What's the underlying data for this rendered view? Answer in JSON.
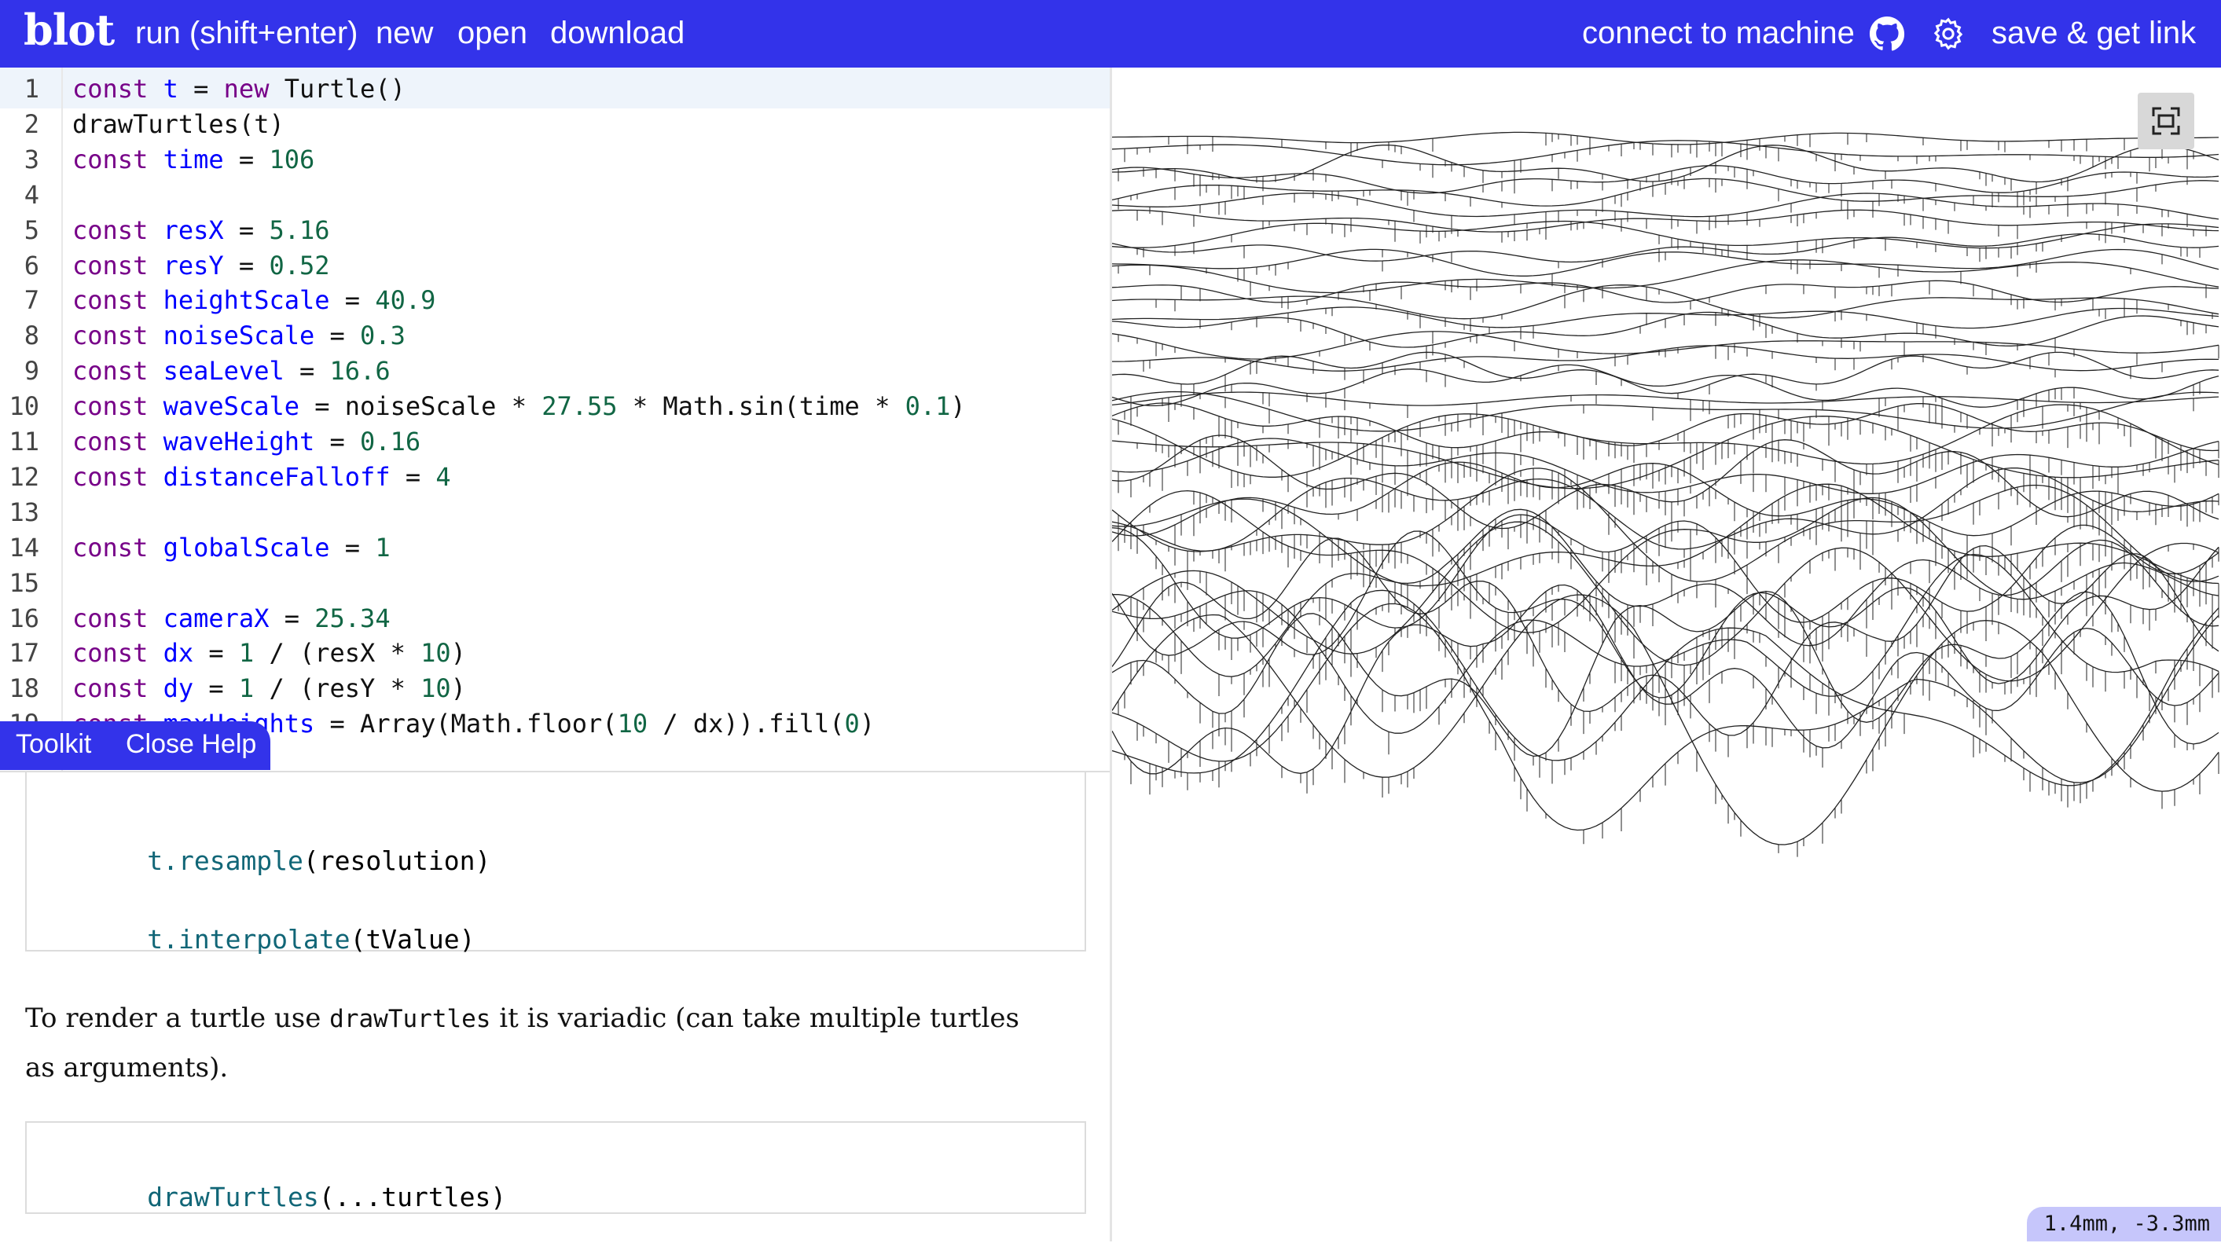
{
  "app": {
    "logo": "blot"
  },
  "nav": {
    "run": "run (shift+enter)",
    "new": "new",
    "open": "open",
    "download": "download",
    "connect": "connect to machine",
    "save": "save & get link"
  },
  "editor": {
    "line_numbers": [
      "1",
      "2",
      "3",
      "4",
      "5",
      "6",
      "7",
      "8",
      "9",
      "10",
      "11",
      "12",
      "13",
      "14",
      "15",
      "16",
      "17",
      "18",
      "19"
    ],
    "lines": [
      [
        {
          "t": "const",
          "c": "kw"
        },
        {
          "t": " "
        },
        {
          "t": "t",
          "c": "def"
        },
        {
          "t": " = "
        },
        {
          "t": "new",
          "c": "kw"
        },
        {
          "t": " Turtle()"
        }
      ],
      [
        {
          "t": "drawTurtles(t)"
        }
      ],
      [
        {
          "t": "const",
          "c": "kw"
        },
        {
          "t": " "
        },
        {
          "t": "time",
          "c": "def"
        },
        {
          "t": " = "
        },
        {
          "t": "106",
          "c": "num"
        }
      ],
      [],
      [
        {
          "t": "const",
          "c": "kw"
        },
        {
          "t": " "
        },
        {
          "t": "resX",
          "c": "def"
        },
        {
          "t": " = "
        },
        {
          "t": "5.16",
          "c": "num"
        }
      ],
      [
        {
          "t": "const",
          "c": "kw"
        },
        {
          "t": " "
        },
        {
          "t": "resY",
          "c": "def"
        },
        {
          "t": " = "
        },
        {
          "t": "0.52",
          "c": "num"
        }
      ],
      [
        {
          "t": "const",
          "c": "kw"
        },
        {
          "t": " "
        },
        {
          "t": "heightScale",
          "c": "def"
        },
        {
          "t": " = "
        },
        {
          "t": "40.9",
          "c": "num"
        }
      ],
      [
        {
          "t": "const",
          "c": "kw"
        },
        {
          "t": " "
        },
        {
          "t": "noiseScale",
          "c": "def"
        },
        {
          "t": " = "
        },
        {
          "t": "0.3",
          "c": "num"
        }
      ],
      [
        {
          "t": "const",
          "c": "kw"
        },
        {
          "t": " "
        },
        {
          "t": "seaLevel",
          "c": "def"
        },
        {
          "t": " = "
        },
        {
          "t": "16.6",
          "c": "num"
        }
      ],
      [
        {
          "t": "const",
          "c": "kw"
        },
        {
          "t": " "
        },
        {
          "t": "waveScale",
          "c": "def"
        },
        {
          "t": " = noiseScale * "
        },
        {
          "t": "27.55",
          "c": "num"
        },
        {
          "t": " * Math.sin(time * "
        },
        {
          "t": "0.1",
          "c": "num"
        },
        {
          "t": ")"
        }
      ],
      [
        {
          "t": "const",
          "c": "kw"
        },
        {
          "t": " "
        },
        {
          "t": "waveHeight",
          "c": "def"
        },
        {
          "t": " = "
        },
        {
          "t": "0.16",
          "c": "num"
        }
      ],
      [
        {
          "t": "const",
          "c": "kw"
        },
        {
          "t": " "
        },
        {
          "t": "distanceFalloff",
          "c": "def"
        },
        {
          "t": " = "
        },
        {
          "t": "4",
          "c": "num"
        }
      ],
      [],
      [
        {
          "t": "const",
          "c": "kw"
        },
        {
          "t": " "
        },
        {
          "t": "globalScale",
          "c": "def"
        },
        {
          "t": " = "
        },
        {
          "t": "1",
          "c": "num"
        }
      ],
      [],
      [
        {
          "t": "const",
          "c": "kw"
        },
        {
          "t": " "
        },
        {
          "t": "cameraX",
          "c": "def"
        },
        {
          "t": " = "
        },
        {
          "t": "25.34",
          "c": "num"
        }
      ],
      [
        {
          "t": "const",
          "c": "kw"
        },
        {
          "t": " "
        },
        {
          "t": "dx",
          "c": "def"
        },
        {
          "t": " = "
        },
        {
          "t": "1",
          "c": "num"
        },
        {
          "t": " / (resX * "
        },
        {
          "t": "10",
          "c": "num"
        },
        {
          "t": ")"
        }
      ],
      [
        {
          "t": "const",
          "c": "kw"
        },
        {
          "t": " "
        },
        {
          "t": "dy",
          "c": "def"
        },
        {
          "t": " = "
        },
        {
          "t": "1",
          "c": "num"
        },
        {
          "t": " / (resY * "
        },
        {
          "t": "10",
          "c": "num"
        },
        {
          "t": ")"
        }
      ],
      [
        {
          "t": "const",
          "c": "kw"
        },
        {
          "t": " "
        },
        {
          "t": "maxHeights",
          "c": "def"
        },
        {
          "t": " = Array(Math.floor("
        },
        {
          "t": "10",
          "c": "num"
        },
        {
          "t": " / dx)).fill("
        },
        {
          "t": "0",
          "c": "num"
        },
        {
          "t": ")"
        }
      ]
    ]
  },
  "help_tabs": {
    "toolkit": "Toolkit",
    "close": "Close Help"
  },
  "help": {
    "box1_line1_obj": "t.",
    "box1_line1_fn": "resample",
    "box1_line1_arg": "(resolution)",
    "box1_line2_obj": "t.",
    "box1_line2_fn": "interpolate",
    "box1_line2_arg": "(tValue)",
    "prose_before": "To render a turtle use ",
    "prose_code": "drawTurtles",
    "prose_after": " it is variadic (can take multiple turtles as arguments).",
    "box2_fn": "drawTurtles",
    "box2_arg": "(...turtles)"
  },
  "viewer": {
    "coords": "1.4mm, -3.3mm"
  },
  "icons": {
    "github": "github-icon",
    "settings": "gear-icon",
    "fit": "fit-to-screen-icon"
  },
  "colors": {
    "brand": "#3333ea",
    "coords_bg": "#c6c6fb"
  }
}
